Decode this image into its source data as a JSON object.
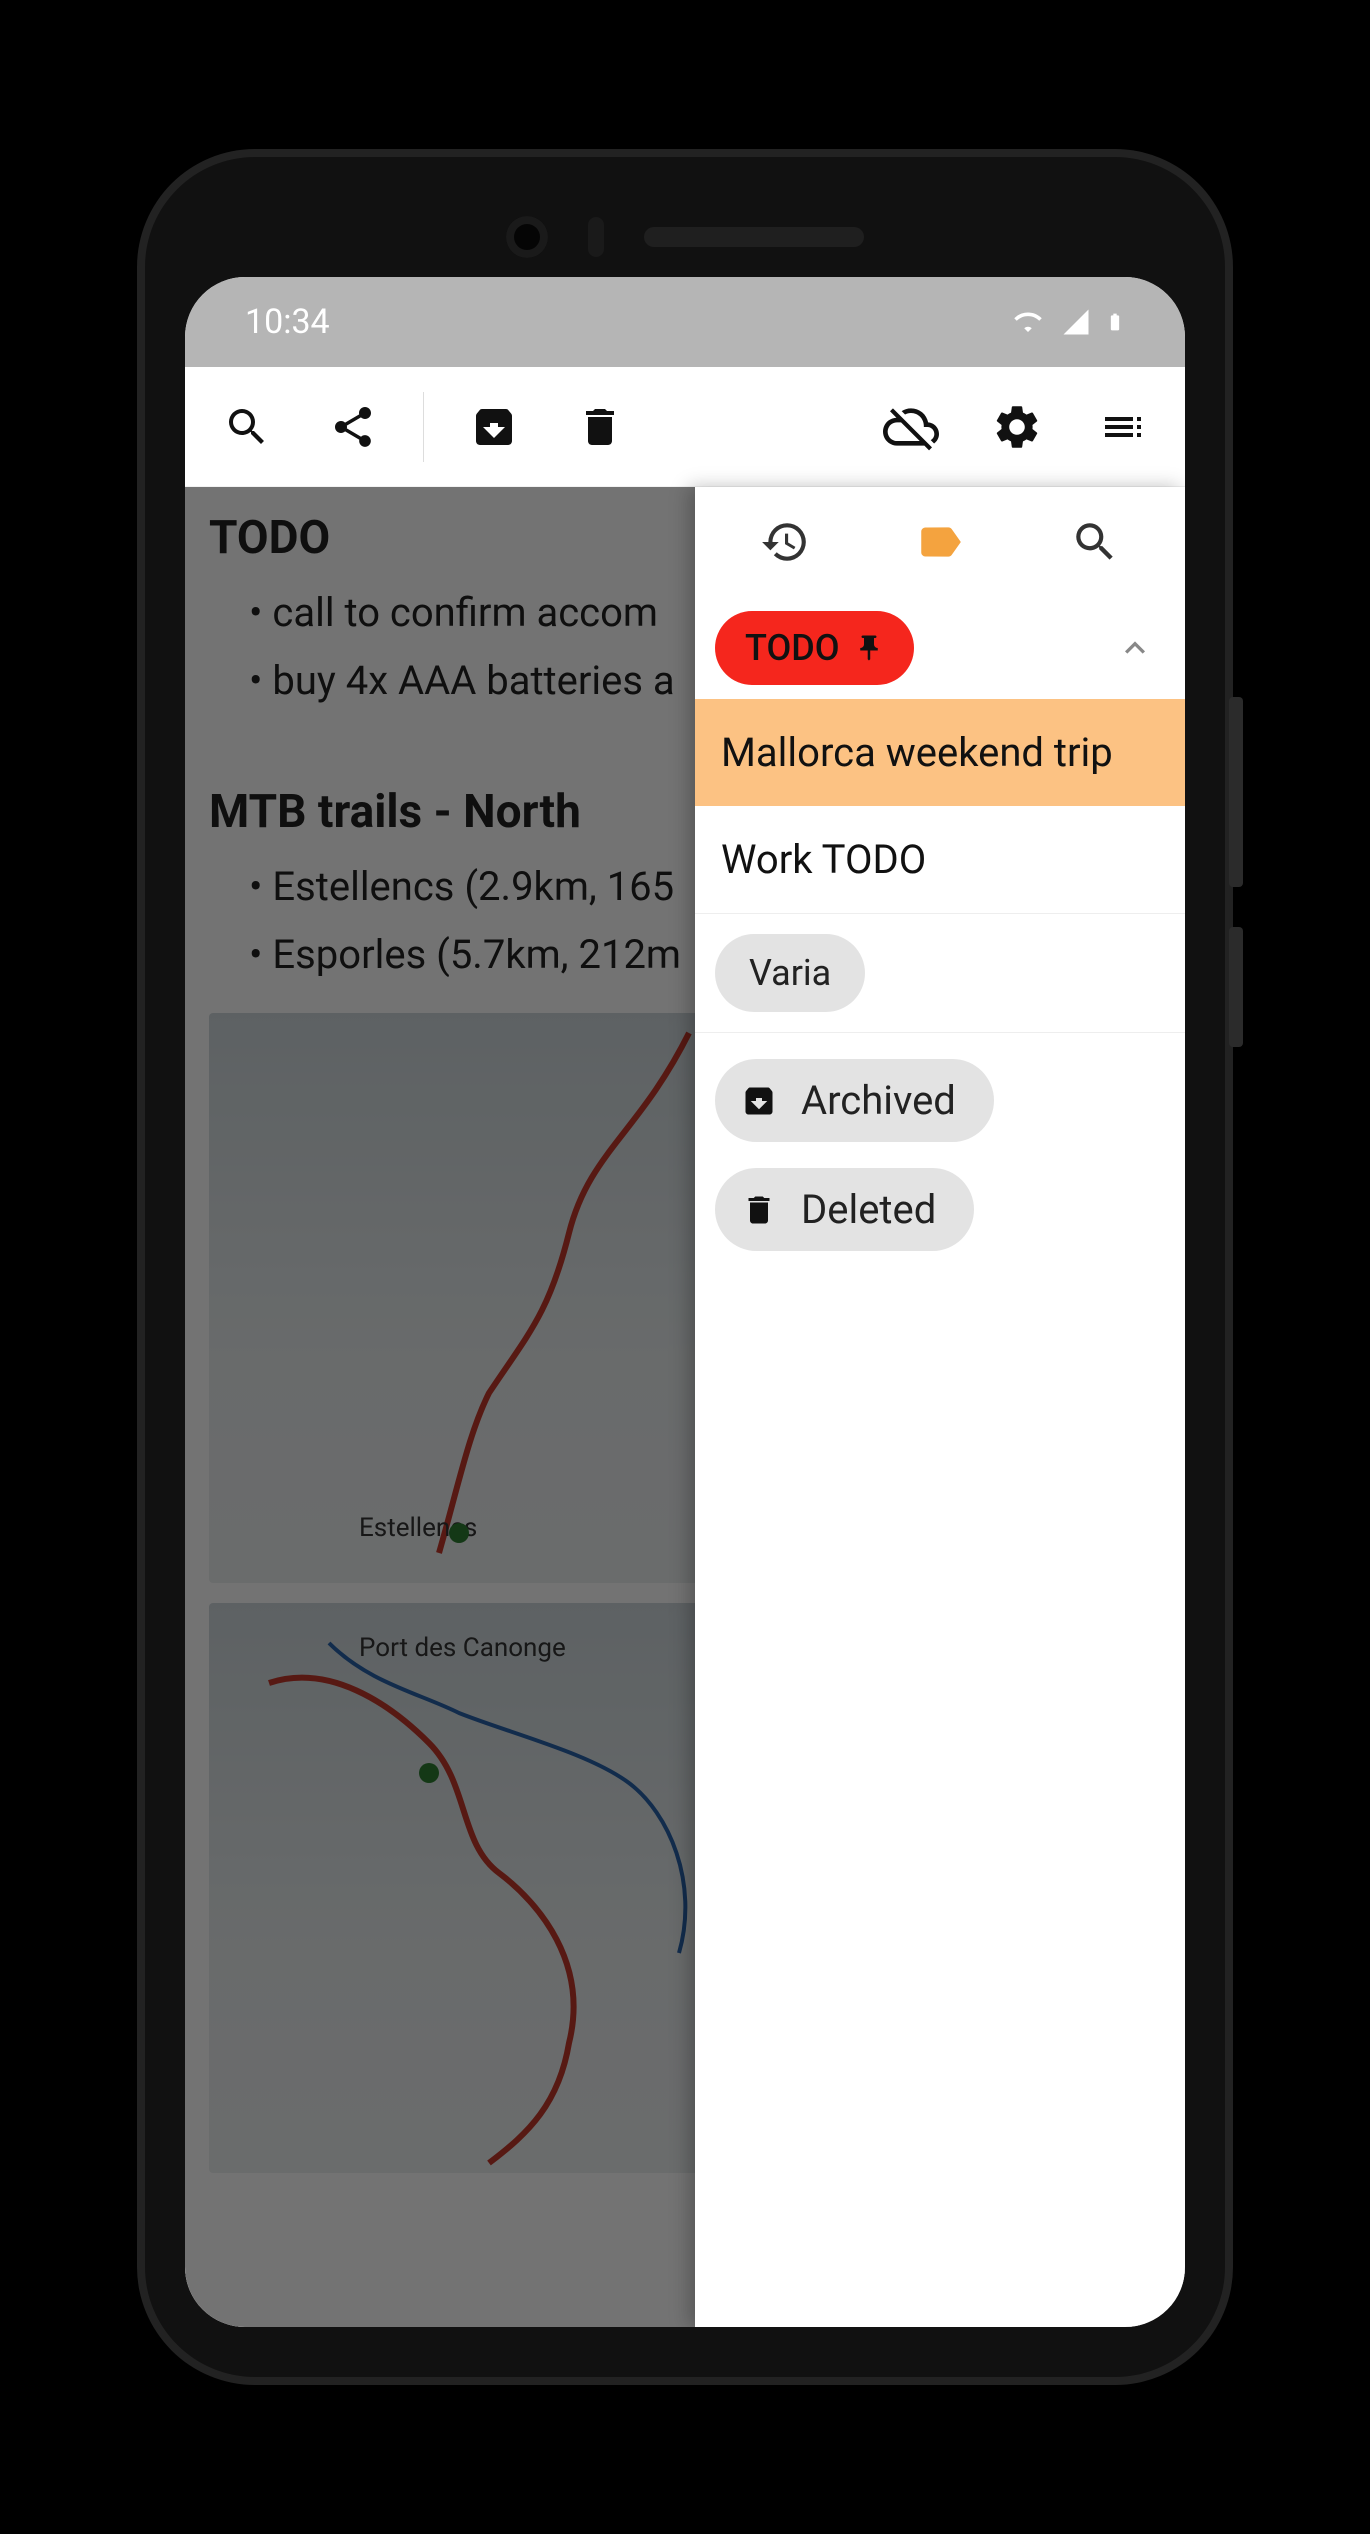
{
  "status": {
    "time": "10:34"
  },
  "note": {
    "title1": "TODO",
    "todo_items": [
      "call to confirm accom",
      "buy 4x AAA batteries a"
    ],
    "title2": "MTB trails - North",
    "trail_items": [
      "Estellencs (2.9km, 165",
      "Esporles (5.7km, 212m"
    ],
    "map1_label": "Estellencs",
    "map2_label": "Port des Canonge"
  },
  "drawer": {
    "pinned_label": "TODO",
    "notes": [
      {
        "label": "Mallorca weekend trip",
        "active": true
      },
      {
        "label": "Work TODO",
        "active": false
      }
    ],
    "tag": "Varia",
    "folders": {
      "archived": "Archived",
      "deleted": "Deleted"
    }
  }
}
